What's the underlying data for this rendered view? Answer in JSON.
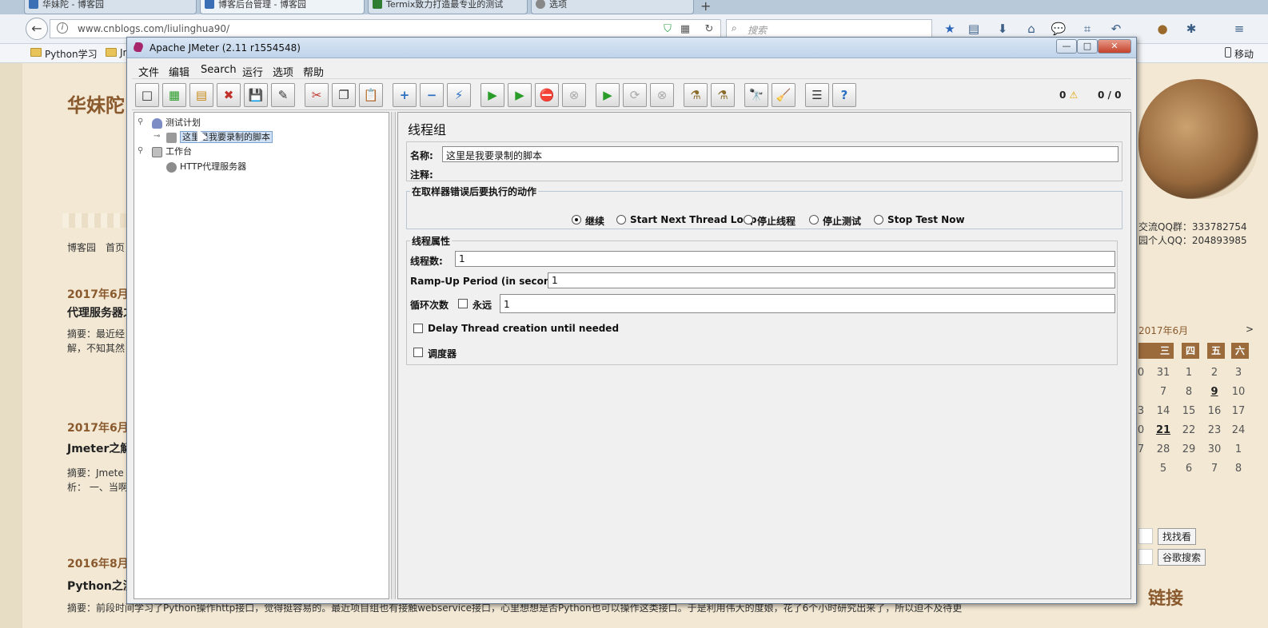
{
  "browser": {
    "tabs": [
      {
        "label": "华妹陀 - 博客园"
      },
      {
        "label": "博客后台管理 - 博客园"
      },
      {
        "label": "Termix致力打造最专业的测试"
      },
      {
        "label": "选项"
      }
    ],
    "url": "www.cnblogs.com/liulinghua90/",
    "search_placeholder": "搜索",
    "bookmarks": {
      "item1": "Python学习",
      "item2": "Jm",
      "mobile": "移动"
    }
  },
  "blog": {
    "title": "华妹陀",
    "nav": {
      "home_site": "博客园",
      "home": "首页"
    },
    "posts": [
      {
        "date": "2017年6月",
        "title": "代理服务器之",
        "summary1": "摘要：最近经",
        "summary2": "解，不知其然"
      },
      {
        "date": "2017年6月",
        "title": "Jmeter之解",
        "summary1": "摘要：Jmete",
        "summary2": "析： 一、当啊"
      },
      {
        "date": "2016年8月",
        "title": "Python之测",
        "summary1": "摘要：前段时间学习了Python操作http接口，觉得挺容易的。最近项目组也有接触webservice接口，心里想想是否Python也可以操作这类接口。于是利用伟大的度娘，花了6个小时研究出来了，所以迫不及待更"
      }
    ],
    "qq_group": "交流QQ群：333782754",
    "qq_personal": "园个人QQ：204893985",
    "calendar": {
      "title": "2017年6月",
      "next": ">",
      "headers": [
        "三",
        "四",
        "五",
        "六"
      ],
      "rows": [
        [
          "0",
          "31",
          "1",
          "2",
          "3"
        ],
        [
          "",
          "7",
          "8",
          "9",
          "10"
        ],
        [
          "3",
          "14",
          "15",
          "16",
          "17"
        ],
        [
          "0",
          "21",
          "22",
          "23",
          "24"
        ],
        [
          "7",
          "28",
          "29",
          "30",
          "1"
        ],
        [
          "",
          "5",
          "6",
          "7",
          "8"
        ]
      ]
    },
    "search_btn": "找找看",
    "google_btn": "谷歌搜索",
    "links_heading": "链接"
  },
  "jmeter": {
    "window_title": "Apache JMeter (2.11 r1554548)",
    "window_buttons": {
      "min": "—",
      "max": "□",
      "close": "✕"
    },
    "menu": [
      "文件",
      "编辑",
      "Search",
      "运行",
      "选项",
      "帮助"
    ],
    "toolbar_glyphs": [
      "□",
      "▦",
      "▤",
      "✖",
      "💾",
      "✎",
      "✂",
      "❐",
      "📋",
      "+",
      "−",
      "⚡",
      "▶",
      "▶",
      "⛔",
      "⊗",
      "▶",
      "⟳",
      "⊗",
      "⚗",
      "⚗",
      "🔭",
      "🧹",
      "☰",
      "?"
    ],
    "status_errors": "0",
    "status_threads": "0 / 0",
    "tree": {
      "plan": "测试计划",
      "thread_group": "这里是我要录制的脚本",
      "workbench": "工作台",
      "proxy": "HTTP代理服务器"
    },
    "form": {
      "title": "线程组",
      "name_label": "名称:",
      "name_value": "这里是我要录制的脚本",
      "comment_label": "注释:",
      "action_group_title": "在取样器错误后要执行的动作",
      "actions": [
        "继续",
        "Start Next Thread Loop",
        "停止线程",
        "停止测试",
        "Stop Test Now"
      ],
      "selected_action": "继续",
      "props_group_title": "线程属性",
      "threads_label": "线程数:",
      "threads_value": "1",
      "rampup_label": "Ramp-Up Period (in seconds):",
      "rampup_value": "1",
      "loop_label": "循环次数",
      "forever_label": "永远",
      "loop_value": "1",
      "delay_label": "Delay Thread creation until needed",
      "scheduler_label": "调度器"
    }
  }
}
